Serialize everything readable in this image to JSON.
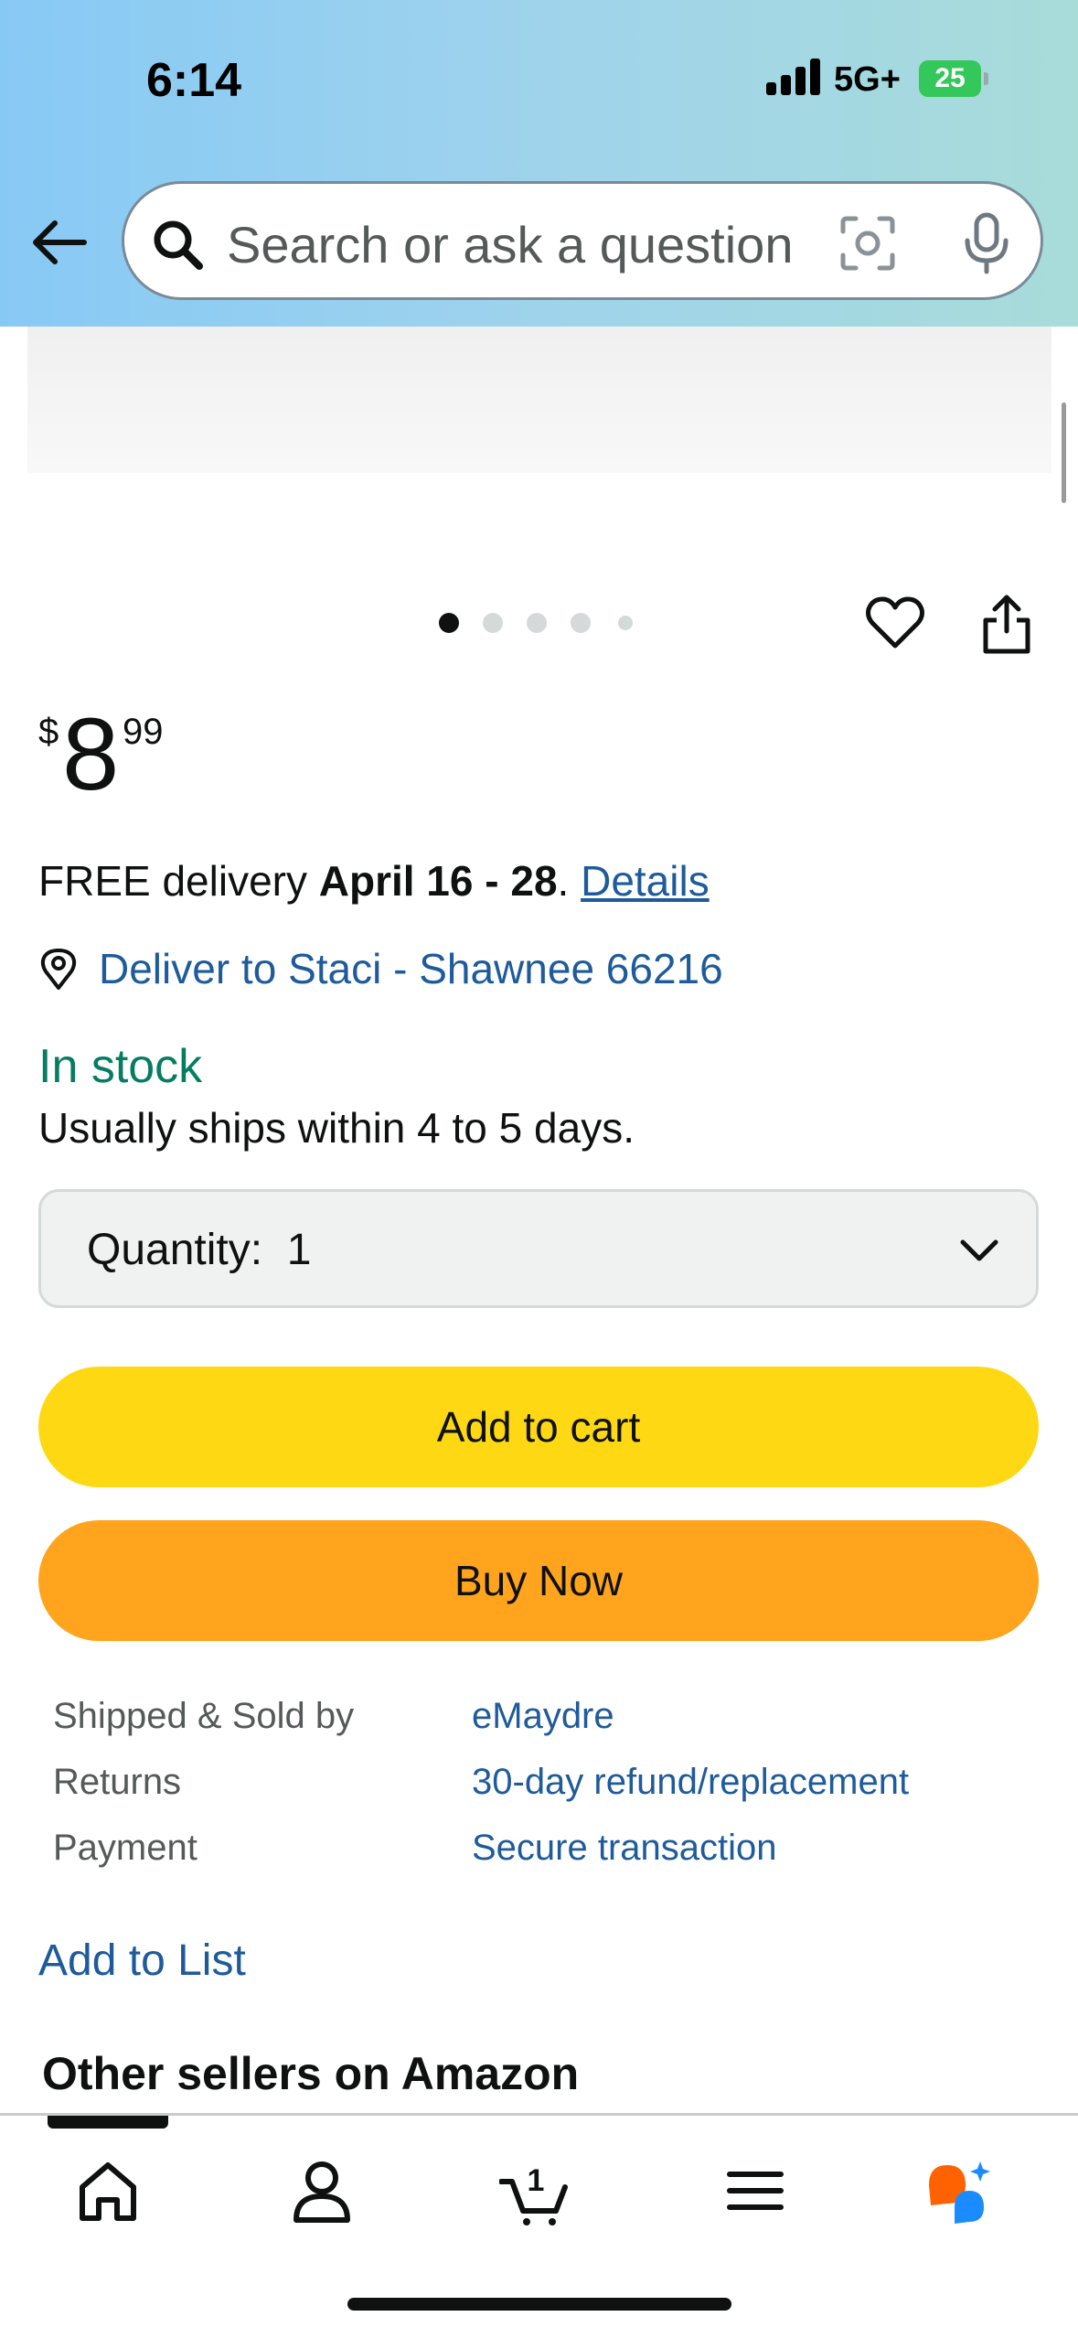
{
  "status_bar": {
    "time": "6:14",
    "network": "5G+",
    "battery": "25"
  },
  "search": {
    "placeholder": "Search or ask a question"
  },
  "carousel": {
    "total_images": 5,
    "active_index": 0
  },
  "product": {
    "price_symbol": "$",
    "price_whole": "8",
    "price_fraction": "99"
  },
  "delivery": {
    "prefix": "FREE delivery ",
    "dates": "April 16 - 28",
    "suffix": ". ",
    "details_link": "Details"
  },
  "deliver_to": {
    "label": "Deliver to Staci - Shawnee 66216"
  },
  "stock": {
    "status": "In stock",
    "shipping_note": "Usually ships within 4 to 5 days."
  },
  "quantity": {
    "label": "Quantity:",
    "value": "1"
  },
  "buttons": {
    "add_to_cart": "Add to cart",
    "buy_now": "Buy Now"
  },
  "seller_info": [
    {
      "label": "Shipped & Sold by",
      "value": "eMaydre"
    },
    {
      "label": "Returns",
      "value": "30-day refund/replacement"
    },
    {
      "label": "Payment",
      "value": "Secure transaction"
    }
  ],
  "add_to_list": "Add to List",
  "section_heading": "Other sellers on Amazon",
  "tabbar": {
    "items": [
      "home-icon",
      "account-icon",
      "cart-icon",
      "menu-icon",
      "rufus-ai-icon"
    ],
    "cart_count": "1",
    "active": "home"
  },
  "colors": {
    "link": "#1f5b9a",
    "in_stock": "#067d62",
    "add_to_cart": "#ffd814",
    "buy_now": "#ffa41c"
  }
}
